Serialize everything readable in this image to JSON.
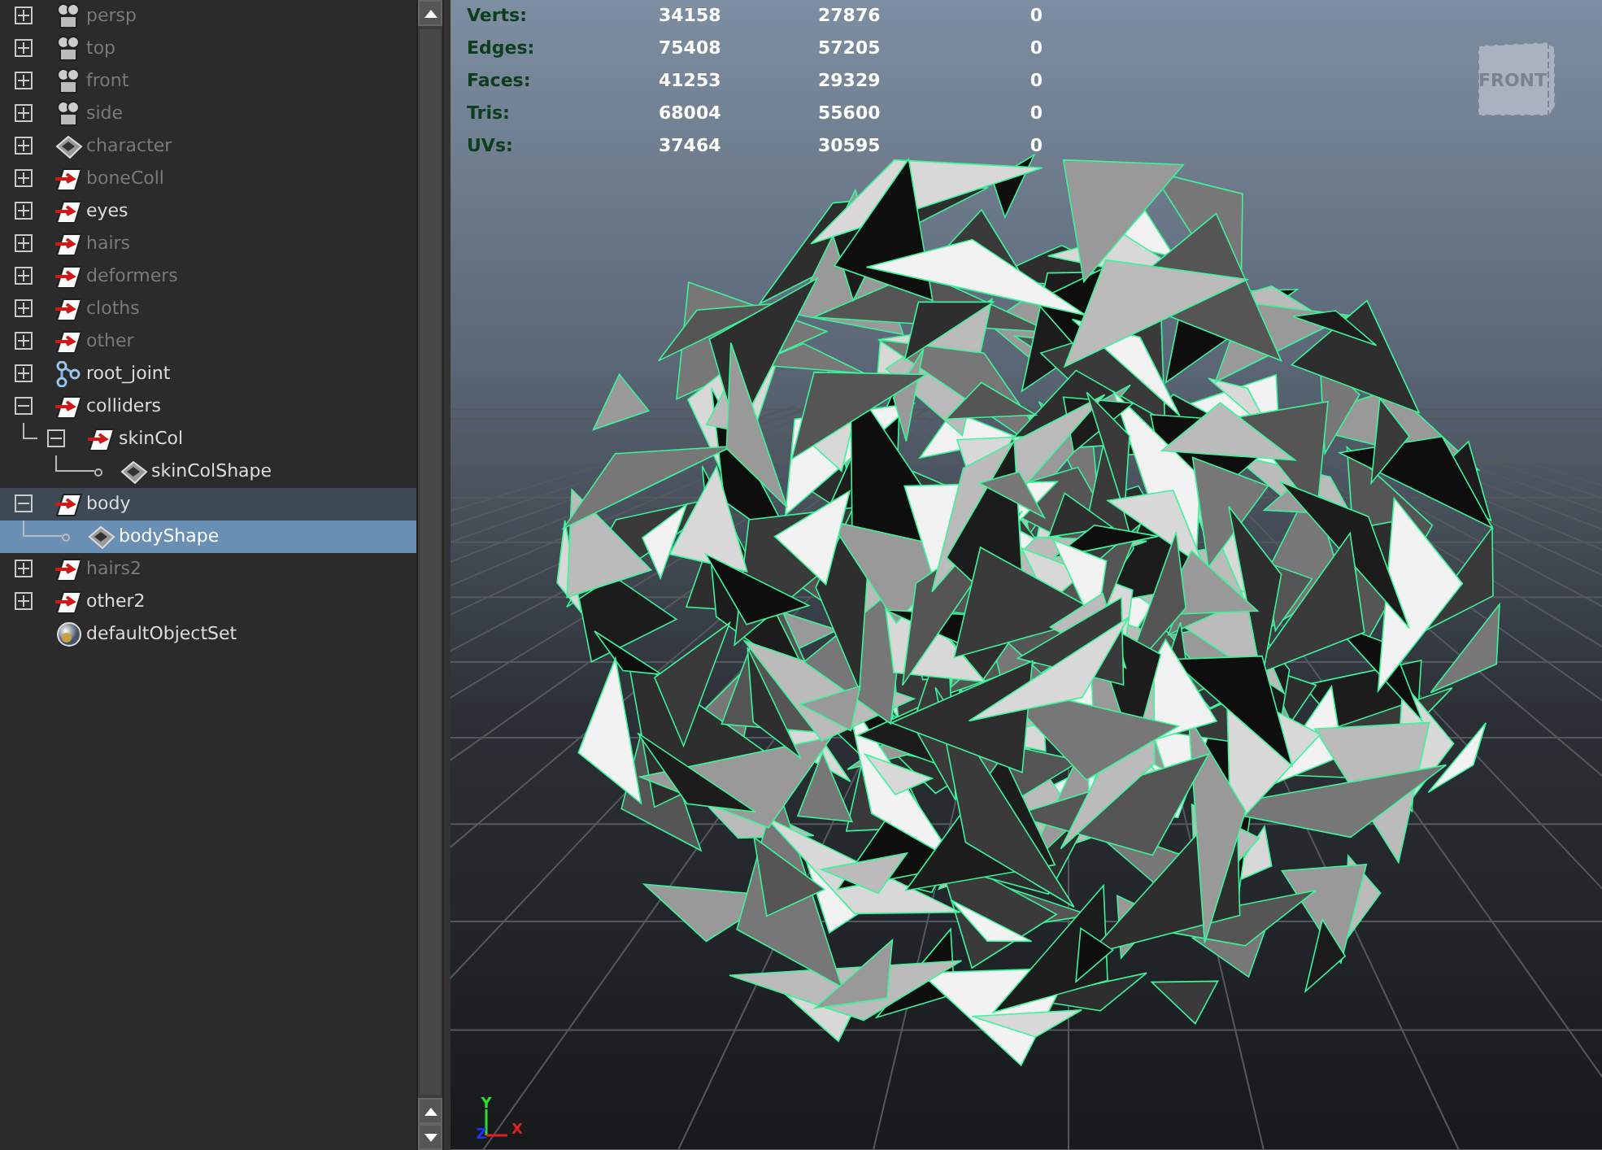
{
  "outliner": {
    "items": [
      {
        "label": "persp",
        "kind": "camera",
        "dimmed": true,
        "expanded": false,
        "selected": false
      },
      {
        "label": "top",
        "kind": "camera",
        "dimmed": true,
        "expanded": false,
        "selected": false
      },
      {
        "label": "front",
        "kind": "camera",
        "dimmed": true,
        "expanded": false,
        "selected": false
      },
      {
        "label": "side",
        "kind": "camera",
        "dimmed": true,
        "expanded": false,
        "selected": false
      },
      {
        "label": "character",
        "kind": "mesh",
        "dimmed": true,
        "expanded": false,
        "selected": false
      },
      {
        "label": "boneColl",
        "kind": "transform",
        "dimmed": true,
        "expanded": false,
        "selected": false
      },
      {
        "label": "eyes",
        "kind": "transform",
        "dimmed": false,
        "expanded": false,
        "selected": false
      },
      {
        "label": "hairs",
        "kind": "transform",
        "dimmed": true,
        "expanded": false,
        "selected": false
      },
      {
        "label": "deformers",
        "kind": "transform",
        "dimmed": true,
        "expanded": false,
        "selected": false
      },
      {
        "label": "cloths",
        "kind": "transform",
        "dimmed": true,
        "expanded": false,
        "selected": false
      },
      {
        "label": "other",
        "kind": "transform",
        "dimmed": true,
        "expanded": false,
        "selected": false
      },
      {
        "label": "root_joint",
        "kind": "joint",
        "dimmed": false,
        "expanded": false,
        "selected": false
      },
      {
        "label": "colliders",
        "kind": "transform",
        "dimmed": false,
        "expanded": true,
        "selected": false,
        "children": [
          {
            "label": "skinCol",
            "kind": "transform",
            "dimmed": false,
            "expanded": true,
            "selected": false,
            "children": [
              {
                "label": "skinColShape",
                "kind": "mesh",
                "dimmed": false,
                "selected": false
              }
            ]
          }
        ]
      },
      {
        "label": "body",
        "kind": "transform",
        "dimmed": false,
        "expanded": true,
        "selected": false,
        "children": [
          {
            "label": "bodyShape",
            "kind": "mesh",
            "dimmed": false,
            "selected": true
          }
        ]
      },
      {
        "label": "hairs2",
        "kind": "transform",
        "dimmed": true,
        "expanded": false,
        "selected": false
      },
      {
        "label": "other2",
        "kind": "transform",
        "dimmed": false,
        "expanded": false,
        "selected": false
      },
      {
        "label": "defaultObjectSet",
        "kind": "set",
        "dimmed": false,
        "selected": false
      }
    ]
  },
  "viewport": {
    "stats": [
      {
        "label": "Verts:",
        "values": [
          "34158",
          "27876",
          "0"
        ]
      },
      {
        "label": "Edges:",
        "values": [
          "75408",
          "57205",
          "0"
        ]
      },
      {
        "label": "Faces:",
        "values": [
          "41253",
          "29329",
          "0"
        ]
      },
      {
        "label": "Tris:",
        "values": [
          "68004",
          "55600",
          "0"
        ]
      },
      {
        "label": "UVs:",
        "values": [
          "37464",
          "30595",
          "0"
        ]
      }
    ],
    "view_cube": {
      "face": "FRONT"
    },
    "axes": {
      "y": "Y",
      "z": "Z",
      "x": "X"
    }
  }
}
